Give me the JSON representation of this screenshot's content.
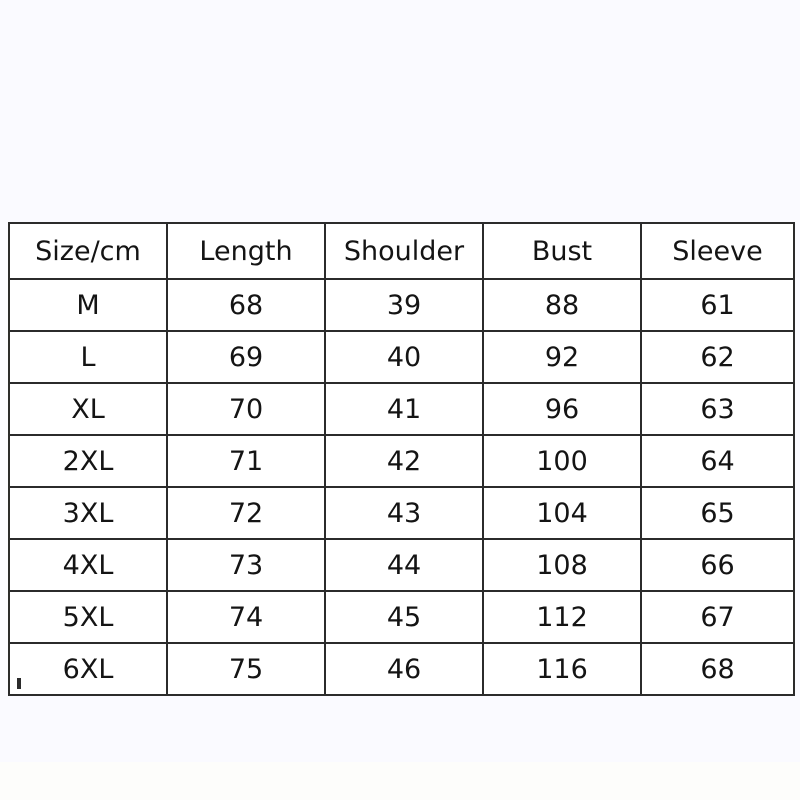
{
  "page": {
    "background_color": "#fafaff",
    "table_border_color": "#2b2b2b",
    "table_background_color": "#ffffff",
    "text_color": "#141414"
  },
  "chart_data": {
    "type": "table",
    "title": "",
    "columns": [
      "Size/cm",
      "Length",
      "Shoulder",
      "Bust",
      "Sleeve"
    ],
    "categories": [
      "M",
      "L",
      "XL",
      "2XL",
      "3XL",
      "4XL",
      "5XL",
      "6XL"
    ],
    "rows": [
      [
        "M",
        "68",
        "39",
        "88",
        "61"
      ],
      [
        "L",
        "69",
        "40",
        "92",
        "62"
      ],
      [
        "XL",
        "70",
        "41",
        "96",
        "63"
      ],
      [
        "2XL",
        "71",
        "42",
        "100",
        "64"
      ],
      [
        "3XL",
        "72",
        "43",
        "104",
        "65"
      ],
      [
        "4XL",
        "73",
        "44",
        "108",
        "66"
      ],
      [
        "5XL",
        "74",
        "45",
        "112",
        "67"
      ],
      [
        "6XL",
        "75",
        "46",
        "116",
        "68"
      ]
    ],
    "series": [
      {
        "name": "Length",
        "values": [
          68,
          69,
          70,
          71,
          72,
          73,
          74,
          75
        ]
      },
      {
        "name": "Shoulder",
        "values": [
          39,
          40,
          41,
          42,
          43,
          44,
          45,
          46
        ]
      },
      {
        "name": "Bust",
        "values": [
          88,
          92,
          96,
          100,
          104,
          108,
          112,
          116
        ]
      },
      {
        "name": "Sleeve",
        "values": [
          61,
          62,
          63,
          64,
          65,
          66,
          67,
          68
        ]
      }
    ],
    "units": "cm",
    "xlabel": "",
    "ylabel": ""
  }
}
